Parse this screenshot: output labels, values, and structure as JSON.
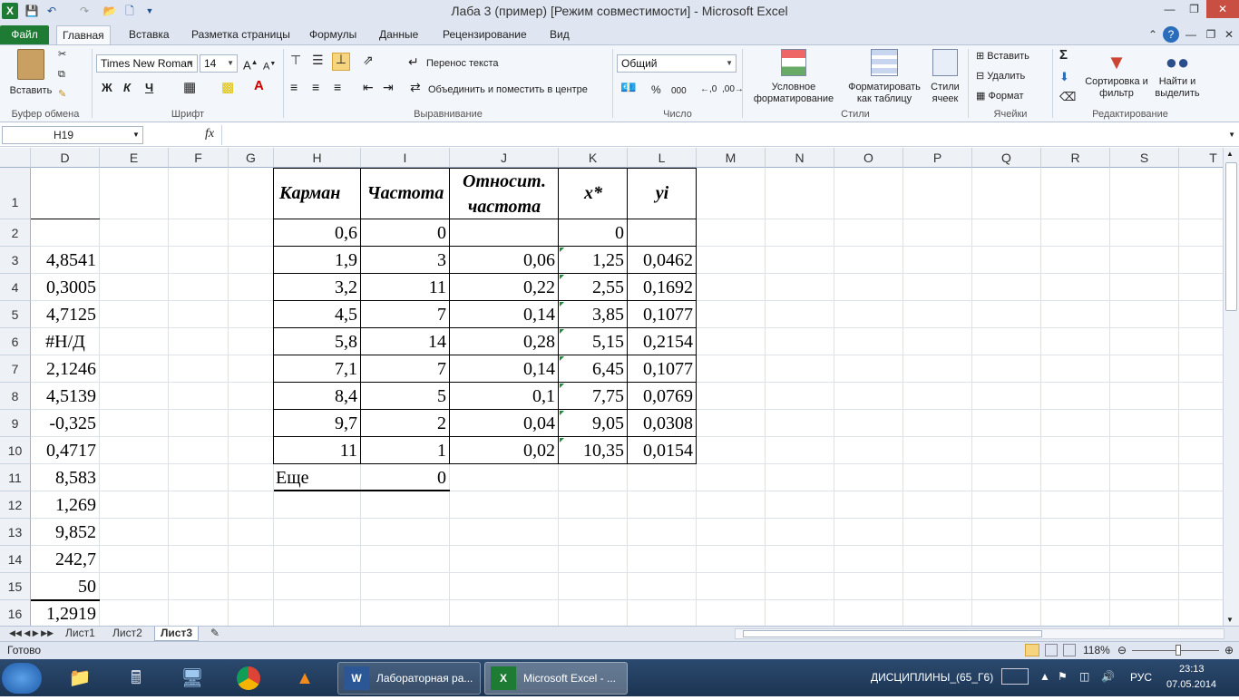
{
  "window": {
    "title": "Лаба 3 (пример)  [Режим совместимости]  -  Microsoft Excel"
  },
  "ribbon_tabs": [
    "Файл",
    "Главная",
    "Вставка",
    "Разметка страницы",
    "Формулы",
    "Данные",
    "Рецензирование",
    "Вид"
  ],
  "ribbon": {
    "clipboard": {
      "paste": "Вставить",
      "group": "Буфер обмена"
    },
    "font": {
      "name": "Times New Roman",
      "size": "14",
      "bold": "Ж",
      "italic": "К",
      "underline": "Ч",
      "group": "Шрифт"
    },
    "alignment": {
      "wrap": "Перенос текста",
      "merge": "Объединить и поместить в центре",
      "group": "Выравнивание"
    },
    "number": {
      "format": "Общий",
      "percent": "%",
      "thousands": "000",
      "group": "Число"
    },
    "styles": {
      "conditional": "Условное форматирование",
      "as_table": "Форматировать как таблицу",
      "cell_styles": "Стили ячеек",
      "group": "Стили"
    },
    "cells": {
      "insert": "Вставить",
      "delete": "Удалить",
      "format": "Формат",
      "group": "Ячейки"
    },
    "editing": {
      "sum": "Σ",
      "sort": "Сортировка и фильтр",
      "find": "Найти и выделить",
      "group": "Редактирование"
    }
  },
  "formula_bar": {
    "name_box": "H19",
    "fx": "fx",
    "value": ""
  },
  "columns": [
    "D",
    "E",
    "F",
    "G",
    "H",
    "I",
    "J",
    "K",
    "L",
    "M",
    "N",
    "O",
    "P",
    "Q",
    "R",
    "S",
    "T"
  ],
  "rows": [
    "1",
    "2",
    "3",
    "4",
    "5",
    "6",
    "7",
    "8",
    "9",
    "10",
    "11",
    "12",
    "13",
    "14",
    "15",
    "16"
  ],
  "col_d_values": [
    "",
    "",
    "4,8541",
    "0,3005",
    "4,7125",
    "#Н/Д",
    "2,1246",
    "4,5139",
    "-0,325",
    "0,4717",
    "8,583",
    "1,269",
    "9,852",
    "242,7",
    "50",
    "1,2919"
  ],
  "table": {
    "headers": [
      "Карман",
      "Частота",
      "Относит. частота",
      "x*",
      "yi"
    ],
    "header_j_line1": "Относит.",
    "header_j_line2": "частота",
    "rows": [
      [
        "0,6",
        "0",
        "",
        "0",
        ""
      ],
      [
        "1,9",
        "3",
        "0,06",
        "1,25",
        "0,0462"
      ],
      [
        "3,2",
        "11",
        "0,22",
        "2,55",
        "0,1692"
      ],
      [
        "4,5",
        "7",
        "0,14",
        "3,85",
        "0,1077"
      ],
      [
        "5,8",
        "14",
        "0,28",
        "5,15",
        "0,2154"
      ],
      [
        "7,1",
        "7",
        "0,14",
        "6,45",
        "0,1077"
      ],
      [
        "8,4",
        "5",
        "0,1",
        "7,75",
        "0,0769"
      ],
      [
        "9,7",
        "2",
        "0,04",
        "9,05",
        "0,0308"
      ],
      [
        "11",
        "1",
        "0,02",
        "10,35",
        "0,0154"
      ]
    ],
    "extra_label": "Еще",
    "extra_value": "0"
  },
  "sheets": [
    "Лист1",
    "Лист2",
    "Лист3"
  ],
  "active_sheet": "Лист3",
  "status": {
    "ready": "Готово",
    "zoom": "118%"
  },
  "taskbar": {
    "word_window": "Лабораторная ра...",
    "excel_window": "Microsoft Excel - ...",
    "tray_text": "ДИСЦИПЛИНЫ_(65_Г6)",
    "lang": "РУС",
    "time": "23:13",
    "date": "07.05.2014"
  },
  "colors": {
    "file_tab": "#1e7b34",
    "taskbar": "#1c3452",
    "error_triangle": "#1e8a3a"
  }
}
